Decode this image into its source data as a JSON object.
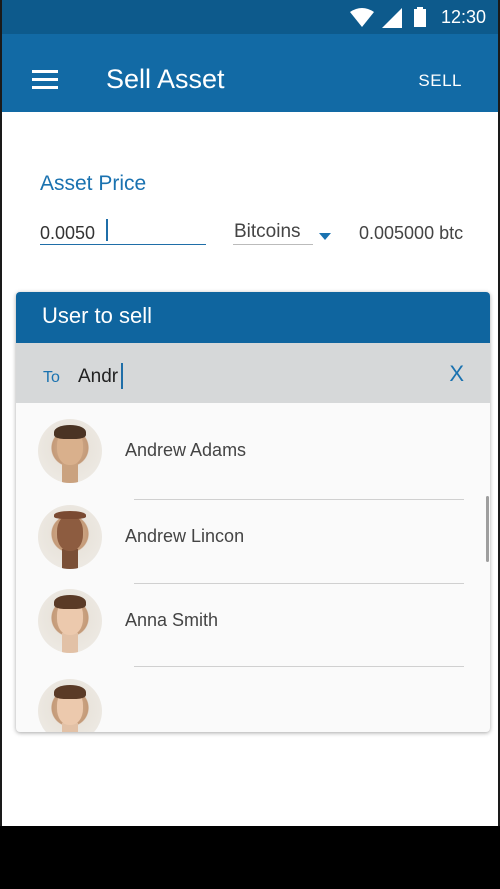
{
  "status_bar": {
    "time": "12:30",
    "icons": [
      "wifi-icon",
      "signal-icon",
      "battery-icon"
    ]
  },
  "app_bar": {
    "title": "Sell Asset",
    "action": "SELL",
    "menu_icon": "menu-icon"
  },
  "asset_price": {
    "label": "Asset Price",
    "value": "0.0050",
    "currency": "Bitcoins",
    "converted": "0.005000 btc"
  },
  "user_card": {
    "title": "User to sell",
    "to_label": "To",
    "search_value": "Andr",
    "clear_label": "X",
    "users": [
      {
        "name": "Andrew Adams"
      },
      {
        "name": "Andrew Lincon"
      },
      {
        "name": "Anna Smith"
      },
      {
        "name": ""
      }
    ]
  },
  "colors": {
    "primary": "#126aa5",
    "primary_dark": "#0d5a8c",
    "accent": "#1a72b0"
  }
}
